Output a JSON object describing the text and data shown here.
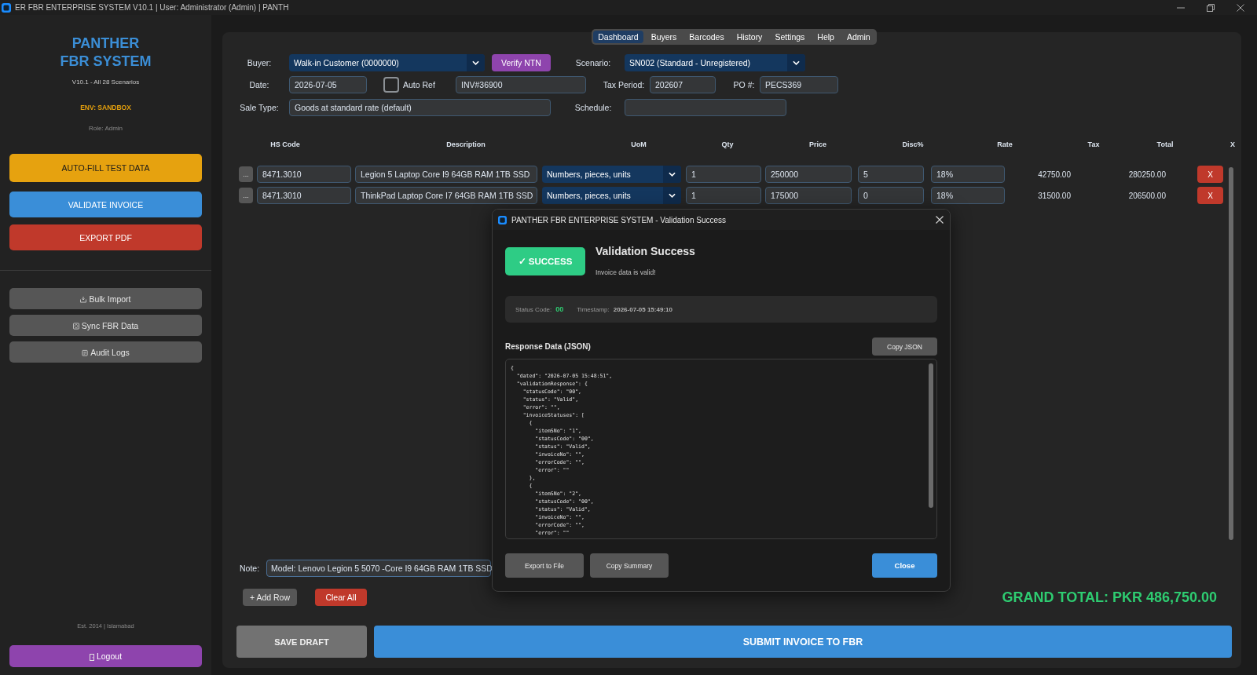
{
  "window": {
    "title": "ER FBR ENTERPRISE SYSTEM V10.1 | User: Administrator (Admin) | PANTH"
  },
  "sidebar": {
    "brand": "PANTHER\nFBR SYSTEM",
    "version": "V10.1 - All 28 Scenarios",
    "environment": "ENV: SANDBOX",
    "role": "Role: Admin",
    "actions": [
      {
        "label": "AUTO-FILL TEST DATA",
        "kind": "warning"
      },
      {
        "label": "VALIDATE INVOICE",
        "kind": "primary"
      },
      {
        "label": "EXPORT PDF",
        "kind": "danger"
      }
    ],
    "tools": [
      {
        "label": "Bulk Import",
        "kind": "import"
      },
      {
        "label": "Sync FBR Data",
        "kind": "sync"
      },
      {
        "label": "Audit Logs",
        "kind": "logs"
      }
    ],
    "footer": "Est. 2014 | Islamabad",
    "logout": "Logout"
  },
  "nav_tabs": [
    {
      "label": "Dashboard",
      "selected": true
    },
    {
      "label": "Buyers",
      "selected": false
    },
    {
      "label": "Barcodes",
      "selected": false
    },
    {
      "label": "History",
      "selected": false
    },
    {
      "label": "Settings",
      "selected": false
    },
    {
      "label": "Help",
      "selected": false
    },
    {
      "label": "Admin",
      "selected": false
    }
  ],
  "form": {
    "buyer": {
      "label": "Buyer:",
      "value": "Walk-in Customer (0000000)"
    },
    "verify_button": "Verify NTN",
    "scenario": {
      "label": "Scenario:",
      "value": "SN002 (Standard - Unregistered)"
    },
    "date": {
      "label": "Date:",
      "value": "2026-07-05"
    },
    "auto_ref": {
      "label": "Auto Ref",
      "checked": false
    },
    "reference": {
      "value": "INV#36900"
    },
    "tax_period": {
      "label": "Tax Period:",
      "value": "202607"
    },
    "po_number": {
      "label": "PO #:",
      "value": "PECS369"
    },
    "sale_type": {
      "label": "Sale Type:",
      "value": "Goods at standard rate (default)"
    },
    "schedule": {
      "label": "Schedule:"
    }
  },
  "table": {
    "columns": [
      "HS Code",
      "Description",
      "UoM",
      "Qty",
      "Price",
      "Disc%",
      "Rate",
      "Tax",
      "Total",
      "X"
    ],
    "rows": [
      {
        "menu": "...",
        "hs_code": "8471.3010",
        "description": "Legion 5 Laptop Core I9 64GB RAM 1TB SSD",
        "uom": "Numbers, pieces, units",
        "qty": "1",
        "price": "250000",
        "disc": "5",
        "rate": "18%",
        "tax": "42750.00",
        "total": "280250.00",
        "remove": "X"
      },
      {
        "menu": "...",
        "hs_code": "8471.3010",
        "description": "ThinkPad Laptop Core I7 64GB RAM 1TB SSD",
        "uom": "Numbers, pieces, units",
        "qty": "1",
        "price": "175000",
        "disc": "0",
        "rate": "18%",
        "tax": "31500.00",
        "total": "206500.00",
        "remove": "X"
      }
    ]
  },
  "note": {
    "label": "Note:",
    "value": "Model: Lenovo Legion 5 5070 -Core I9 64GB RAM 1TB SSD"
  },
  "table_actions": [
    {
      "label": "+ Add Row",
      "kind": "neutral"
    },
    {
      "label": "Clear All",
      "kind": "danger"
    }
  ],
  "grand_total": "GRAND TOTAL: PKR 486,750.00",
  "footer_buttons": [
    {
      "label": "SAVE DRAFT",
      "kind": "neutral"
    },
    {
      "label": "SUBMIT INVOICE TO FBR",
      "kind": "primary"
    }
  ],
  "dialog": {
    "title": "PANTHER FBR ENTERPRISE SYSTEM - Validation Success",
    "badge": "✓ SUCCESS",
    "heading": "Validation Success",
    "message": "Invoice data is valid!",
    "status_code": {
      "label": "Status Code:",
      "value": "00"
    },
    "timestamp": {
      "label": "Timestamp:",
      "value": "2026-07-05 15:49:10"
    },
    "response_label": "Response Data (JSON)",
    "copy_button": "Copy JSON",
    "response_json": "{\n  \"dated\": \"2026-07-05 15:48:51\",\n  \"validationResponse\": {\n    \"statusCode\": \"00\",\n    \"status\": \"Valid\",\n    \"error\": \"\",\n    \"invoiceStatuses\": [\n      {\n        \"itemSNo\": \"1\",\n        \"statusCode\": \"00\",\n        \"status\": \"Valid\",\n        \"invoiceNo\": \"\",\n        \"errorCode\": \"\",\n        \"error\": \"\"\n      },\n      {\n        \"itemSNo\": \"2\",\n        \"statusCode\": \"00\",\n        \"status\": \"Valid\",\n        \"invoiceNo\": \"\",\n        \"errorCode\": \"\",\n        \"error\": \"\"",
    "buttons": [
      {
        "label": "Export to File",
        "kind": "neutral"
      },
      {
        "label": "Copy Summary",
        "kind": "neutral"
      },
      {
        "label": "Close",
        "kind": "primary"
      }
    ]
  }
}
